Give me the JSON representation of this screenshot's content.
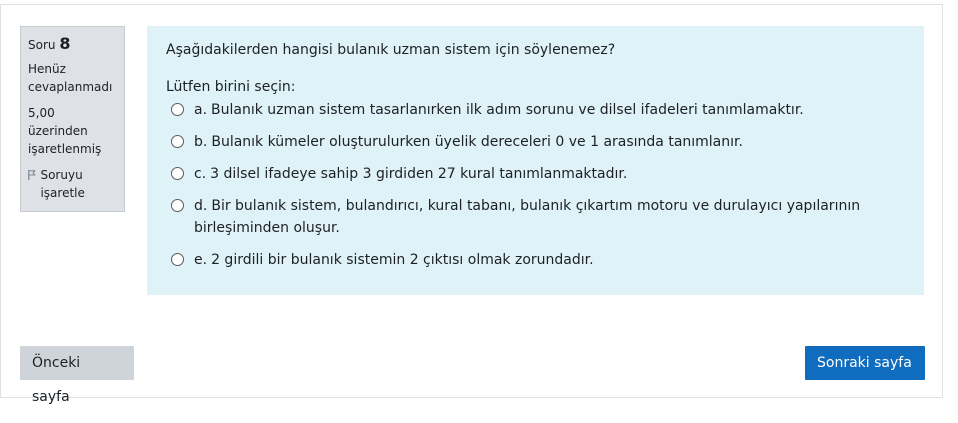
{
  "info": {
    "question_label": "Soru",
    "question_number": "8",
    "status": "Henüz cevaplanmadı",
    "grade": "5,00 üzerinden işaretlenmiş",
    "flag_label": "Soruyu işaretle"
  },
  "question": {
    "text": "Aşağıdakilerden hangisi bulanık uzman sistem için söylenemez?",
    "prompt": "Lütfen birini seçin:",
    "answers": [
      {
        "letter": "a.",
        "text": "Bulanık uzman sistem tasarlanırken ilk adım sorunu ve dilsel ifadeleri tanımlamaktır."
      },
      {
        "letter": "b.",
        "text": "Bulanık kümeler oluşturulurken üyelik dereceleri 0 ve 1 arasında tanımlanır."
      },
      {
        "letter": "c.",
        "text": "3 dilsel ifadeye sahip 3 girdiden 27 kural tanımlanmaktadır."
      },
      {
        "letter": "d.",
        "text": "Bir bulanık sistem, bulandırıcı, kural tabanı, bulanık çıkartım motoru ve durulayıcı yapılarının birleşiminden oluşur."
      },
      {
        "letter": "e.",
        "text": "2 girdili bir bulanık sistemin 2 çıktısı olmak zorundadır."
      }
    ]
  },
  "nav": {
    "prev_label": "Önceki sayfa",
    "next_label": "Sonraki sayfa"
  },
  "colors": {
    "question_bg": "#def2f8",
    "info_bg": "#dee2e6",
    "next_button": "#0f6cbf",
    "prev_button": "#ced4da"
  },
  "icons": {
    "flag": "flag-outline-icon",
    "radio": "radio-unchecked-icon"
  }
}
